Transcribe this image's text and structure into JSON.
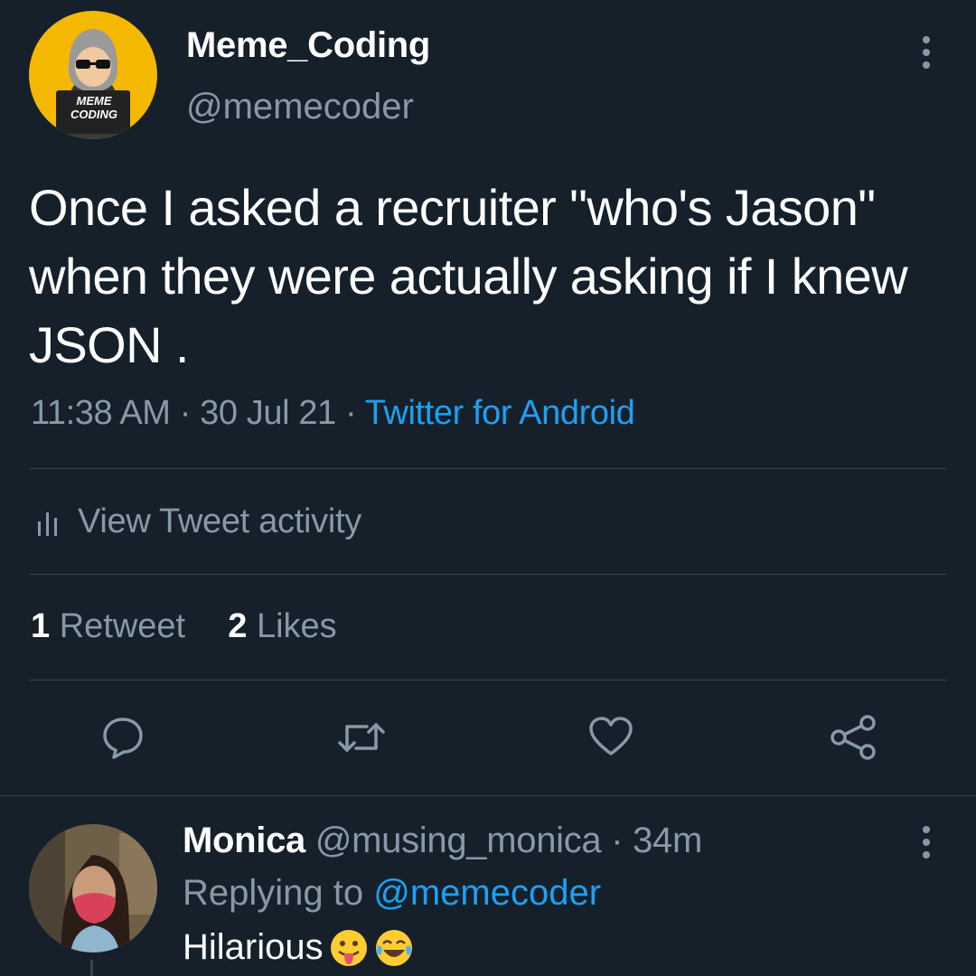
{
  "tweet": {
    "author": {
      "name": "Meme_Coding",
      "handle": "@memecoder",
      "avatar_text_line1": "MEME",
      "avatar_text_line2": "CODING"
    },
    "text": "Once I asked a recruiter \"who's Jason\" when they were actually asking if I knew JSON .",
    "time": "11:38 AM",
    "date": "30 Jul 21",
    "separator": "·",
    "source": "Twitter for Android",
    "activity_label": "View Tweet activity",
    "stats": {
      "retweets_count": "1",
      "retweets_label": "Retweet",
      "likes_count": "2",
      "likes_label": "Likes"
    },
    "actions": [
      "reply-icon",
      "retweet-icon",
      "like-icon",
      "share-icon"
    ]
  },
  "reply": {
    "name": "Monica",
    "handle": "@musing_monica",
    "separator": "·",
    "time_ago": "34m",
    "replying_prefix": "Replying to",
    "replying_to": "@memecoder",
    "text": "Hilarious",
    "emojis": [
      "tongue-out-emoji",
      "tears-of-joy-emoji"
    ]
  },
  "colors": {
    "background": "#15202b",
    "primary_text": "#ffffff",
    "secondary_text": "#8899a6",
    "accent_link": "#1da1f2",
    "divider": "#38444d",
    "avatar_bg": "#f5b800"
  }
}
